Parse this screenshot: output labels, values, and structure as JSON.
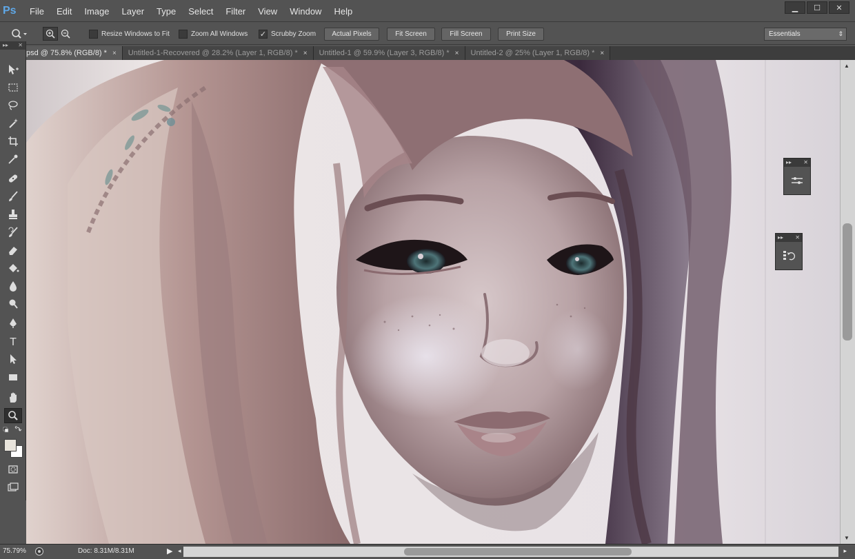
{
  "app": {
    "logo": "Ps"
  },
  "menu": [
    "File",
    "Edit",
    "Image",
    "Layer",
    "Type",
    "Select",
    "Filter",
    "View",
    "Window",
    "Help"
  ],
  "window_controls": {
    "minimize": "▁",
    "maximize": "☐",
    "close": "✕"
  },
  "options": {
    "resize_windows_label": "Resize Windows to Fit",
    "resize_windows_checked": false,
    "zoom_all_label": "Zoom All Windows",
    "zoom_all_checked": false,
    "scrubby_zoom_label": "Scrubby Zoom",
    "scrubby_zoom_checked": true,
    "actual_pixels": "Actual Pixels",
    "fit_screen": "Fit Screen",
    "fill_screen": "Fill Screen",
    "print_size": "Print Size",
    "workspace": "Essentials"
  },
  "tabs": [
    {
      "label": "psd @ 75.8% (RGB/8) *",
      "active": true
    },
    {
      "label": "Untitled-1-Recovered @ 28.2% (Layer 1, RGB/8) *",
      "active": false
    },
    {
      "label": "Untitled-1 @ 59.9% (Layer 3, RGB/8) *",
      "active": false
    },
    {
      "label": "Untitled-2 @ 25% (Layer 1, RGB/8) *",
      "active": false
    }
  ],
  "tab_close_glyph": "×",
  "status": {
    "zoom": "75.79%",
    "doc": "Doc: 8.31M/8.31M"
  },
  "colors": {
    "chrome": "#535353",
    "canvas_bg": "#d9d4d8",
    "foreground_swatch": "#e8e4dc",
    "background_swatch": "#ffffff",
    "ps_logo": "#5fa8e8"
  }
}
